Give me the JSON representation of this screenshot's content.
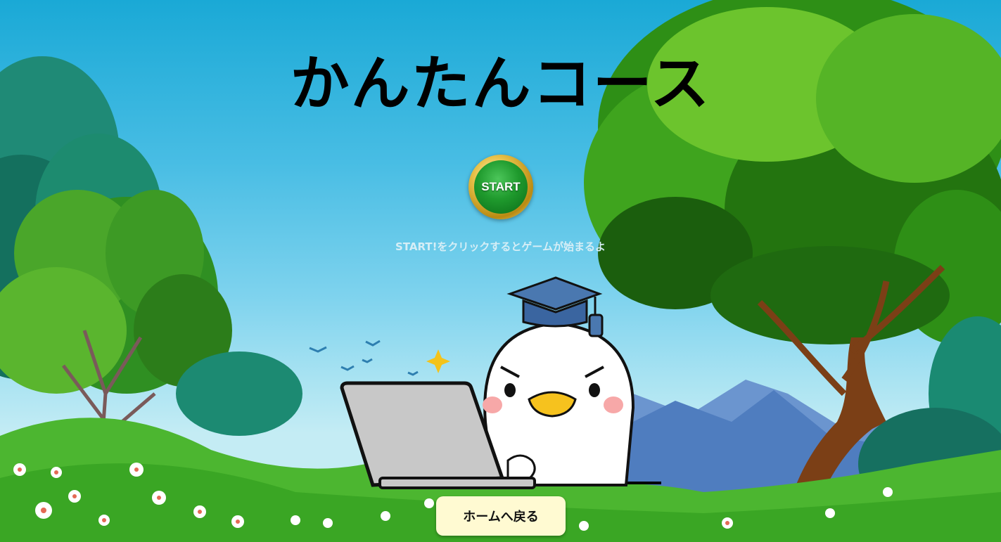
{
  "page": {
    "title": "かんたんコース",
    "start_button_label": "START",
    "hint_text": "START!をクリックするとゲームが始まるよ",
    "home_button_label": "ホームへ戻る"
  },
  "scene": {
    "sky_color": "#1aa9d6",
    "button_green": "#1f9a2d",
    "button_gold": "#d9b13a",
    "home_button_bg": "#fffad2",
    "mascot": "bird-student-with-laptop",
    "elements": [
      "left-forest-trees",
      "right-large-tree",
      "mountains",
      "grass-with-flowers",
      "flying-birds",
      "sparkle"
    ]
  }
}
